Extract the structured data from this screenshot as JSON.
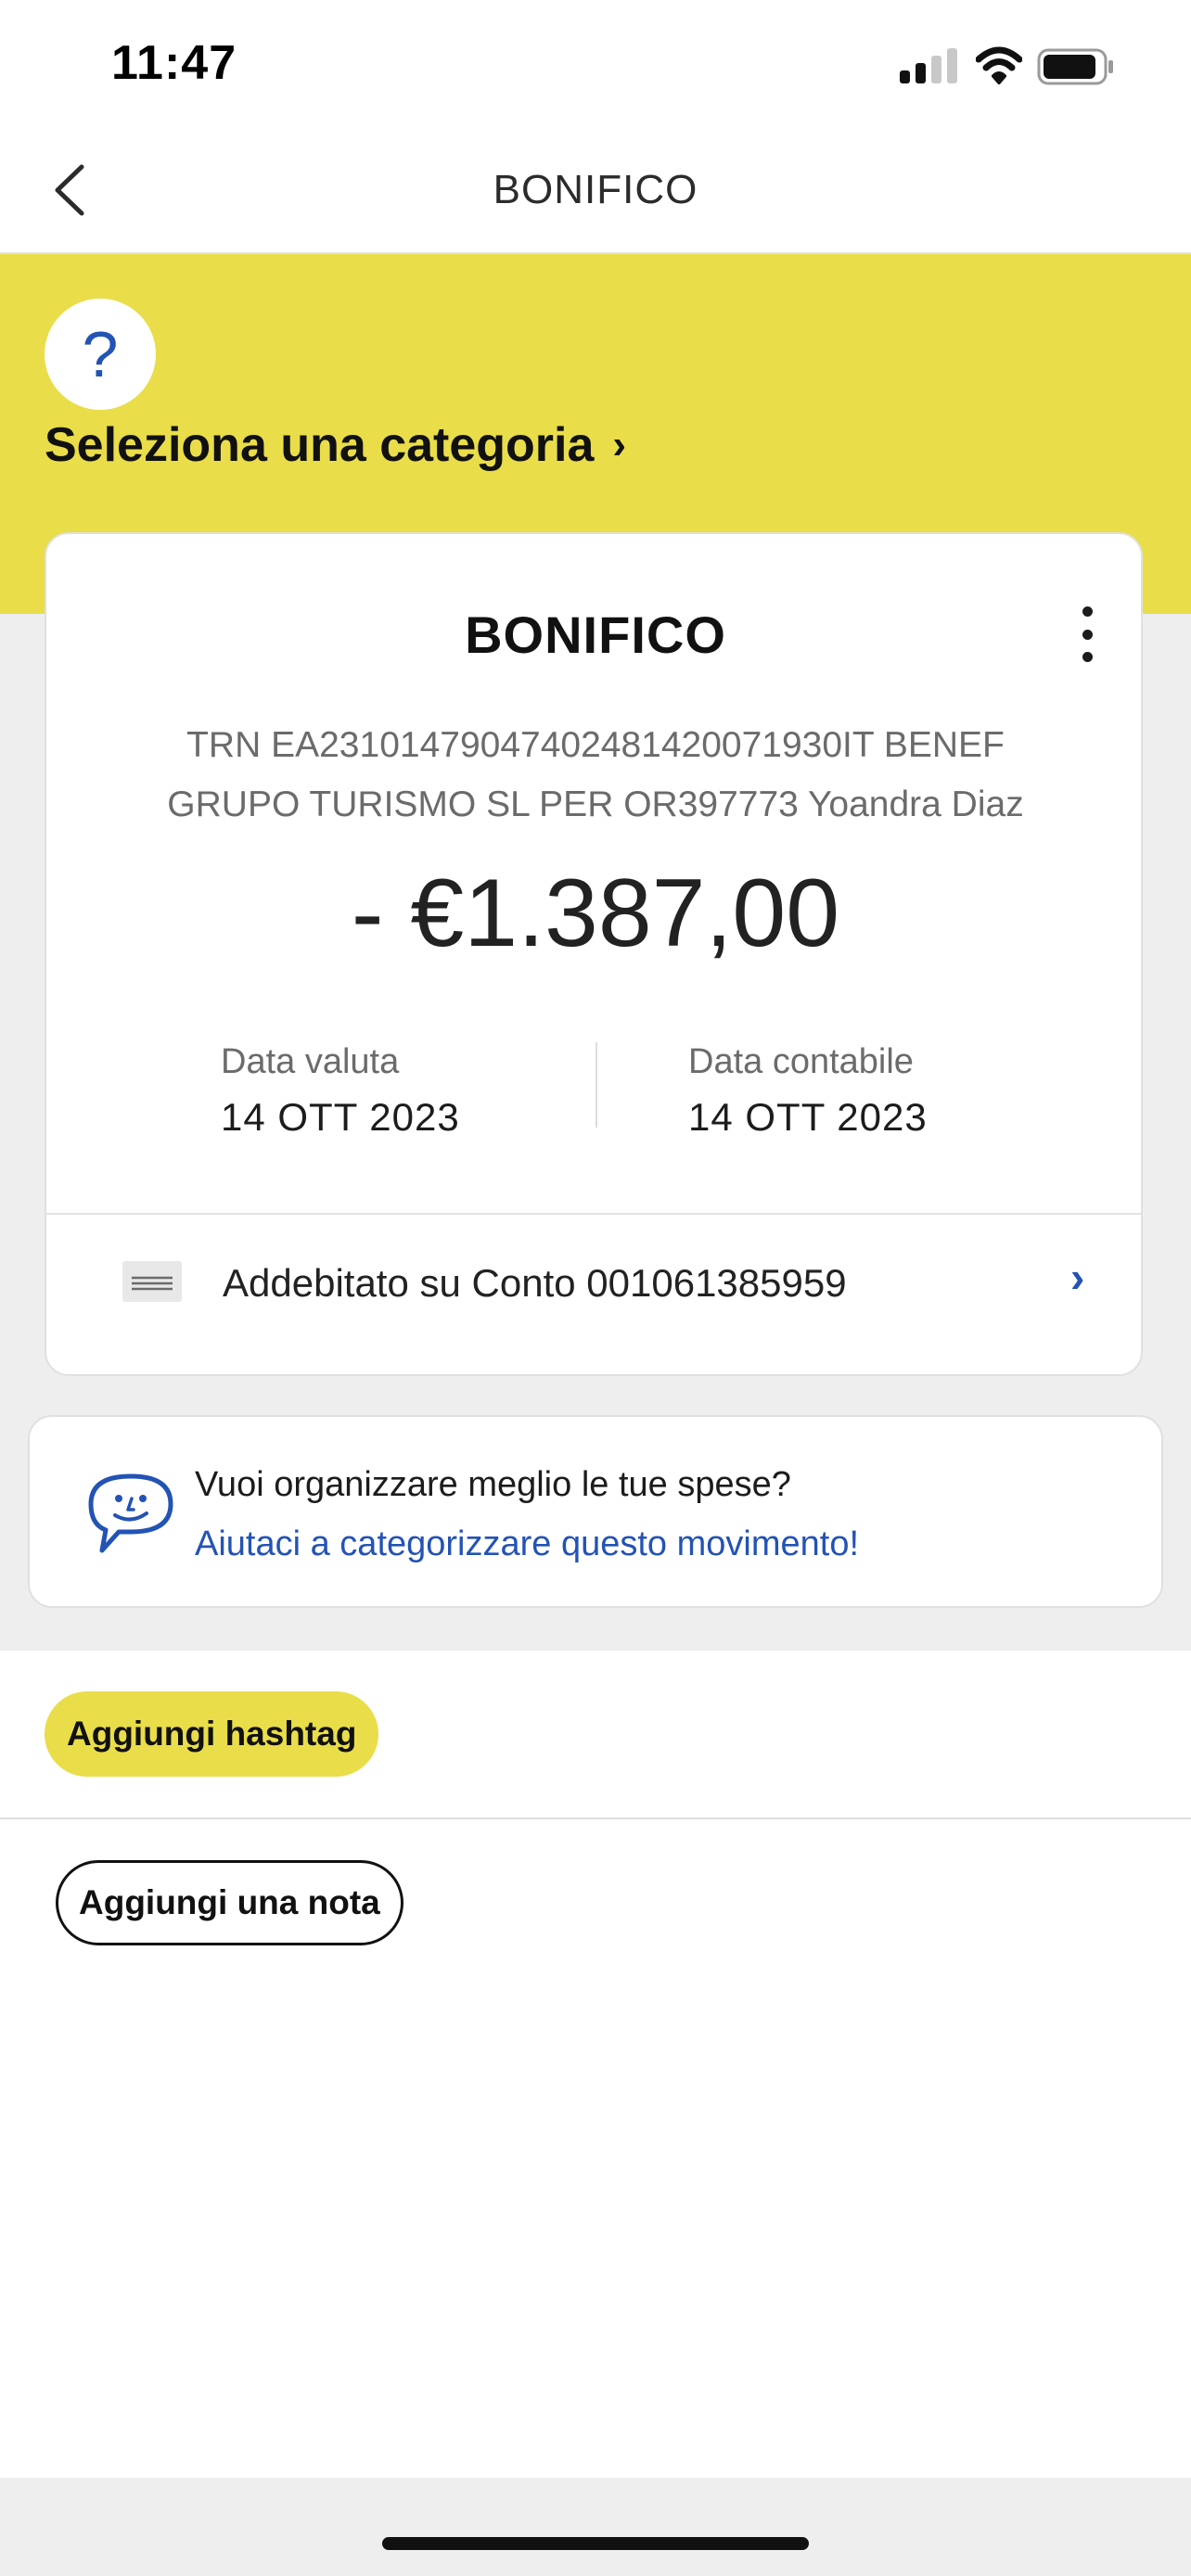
{
  "status_bar": {
    "time": "11:47",
    "icons": [
      "signal-icon",
      "wifi-icon",
      "battery-icon"
    ]
  },
  "nav": {
    "back_icon": "chevron-left-icon",
    "title": "BONIFICO"
  },
  "banner": {
    "help_icon": "?",
    "category_label": "Seleziona una categoria",
    "category_chevron": "›"
  },
  "card": {
    "title": "BONIFICO",
    "description": "TRN EA23101479047402481420071930IT BENEF GRUPO TURISMO SL PER OR397773 Yoandra Diaz",
    "amount": "- €1.387,00",
    "date_valuta_label": "Data valuta",
    "date_valuta_value": "14 OTT 2023",
    "date_contabile_label": "Data contabile",
    "date_contabile_value": "14 OTT 2023",
    "account_label": "Addebitato su Conto 001061385959",
    "account_chevron": "›"
  },
  "categorize": {
    "question": "Vuoi organizzare meglio le tue spese?",
    "cta": "Aiutaci a categorizzare questo movimento!"
  },
  "actions": {
    "hashtag_label": "Aggiungi hashtag",
    "note_label": "Aggiungi una nota"
  },
  "colors": {
    "accent_yellow": "#e9dd4a",
    "link_blue": "#2353b4",
    "background_gray": "#eeeeee"
  }
}
